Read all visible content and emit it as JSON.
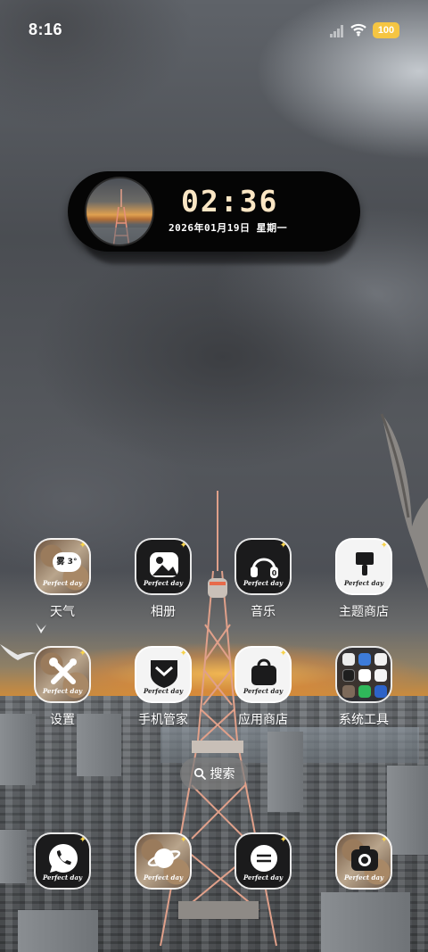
{
  "status_bar": {
    "time": "8:16",
    "battery": "100",
    "battery_color": "#f5c542"
  },
  "clock_widget": {
    "time": "02:36",
    "date": "2026年01月19日 星期一",
    "time_color": "#fbe6c4"
  },
  "icon_caption": "Perfect day",
  "apps": [
    {
      "label": "天气",
      "icon": "weather-icon",
      "badge": "雾 3°"
    },
    {
      "label": "相册",
      "icon": "gallery-icon"
    },
    {
      "label": "音乐",
      "icon": "music-icon"
    },
    {
      "label": "主题商店",
      "icon": "theme-store-icon"
    },
    {
      "label": "设置",
      "icon": "settings-icon"
    },
    {
      "label": "手机管家",
      "icon": "security-icon"
    },
    {
      "label": "应用商店",
      "icon": "app-store-icon"
    },
    {
      "label": "系统工具",
      "icon": "system-tools-folder"
    }
  ],
  "dock": [
    {
      "icon": "phone-icon"
    },
    {
      "icon": "browser-icon"
    },
    {
      "icon": "messages-icon"
    },
    {
      "icon": "camera-icon"
    }
  ],
  "search": {
    "label": "搜索"
  }
}
